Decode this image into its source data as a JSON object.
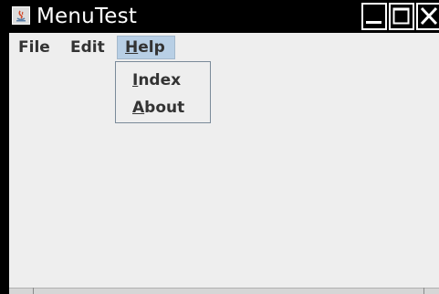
{
  "window": {
    "title": "MenuTest",
    "controls": {
      "minimize_icon": "minimize-icon",
      "maximize_icon": "maximize-icon",
      "close_icon": "close-icon"
    }
  },
  "menubar": {
    "items": [
      {
        "label": "File"
      },
      {
        "label": "Edit"
      },
      {
        "label_mnemonic": "H",
        "label_rest": "elp",
        "active": true
      }
    ]
  },
  "help_menu": {
    "items": [
      {
        "label_mnemonic": "I",
        "label_rest": "ndex"
      },
      {
        "label_mnemonic": "A",
        "label_rest": "bout"
      }
    ]
  },
  "colors": {
    "titlebar": "#000000",
    "title_text": "#ffffff",
    "menu_background": "#eeeeee",
    "menu_selected": "#b8cfe5",
    "menu_text": "#333333"
  }
}
